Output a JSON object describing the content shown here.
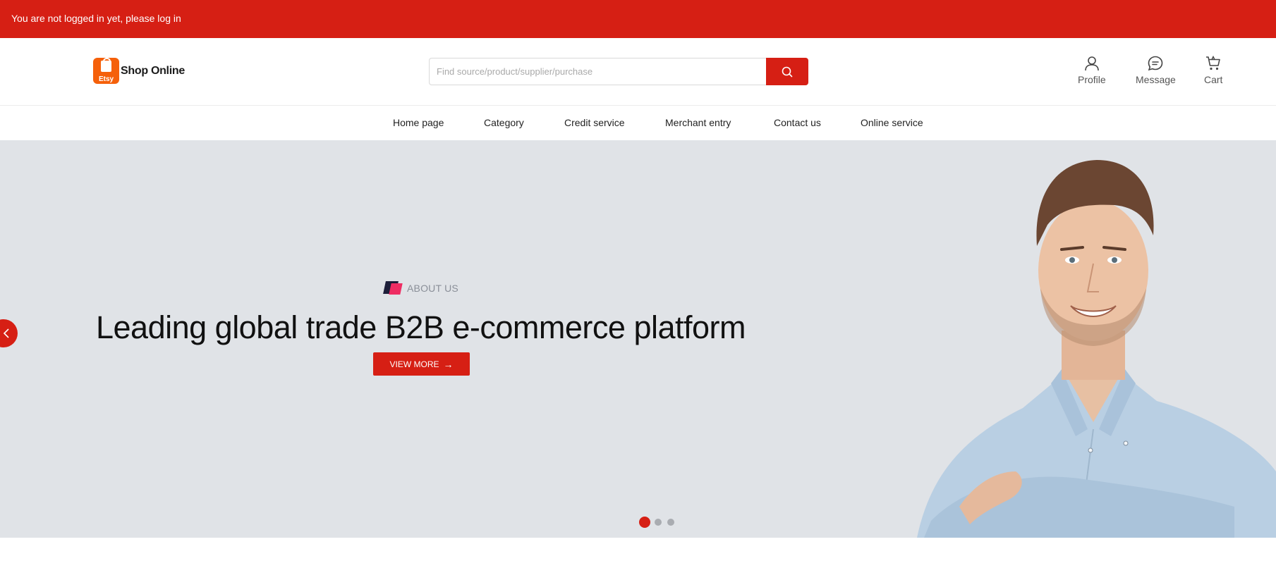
{
  "topbar": {
    "login_notice": "You are not logged in yet, please log in"
  },
  "header": {
    "logo": {
      "badge_text": "Etsy",
      "name": "Shop Online",
      "brand_color": "#f5600a"
    },
    "search": {
      "placeholder": "Find source/product/supplier/purchase",
      "value": "",
      "button_icon": "search-icon"
    },
    "actions": [
      {
        "label": "Profile",
        "icon": "user-icon"
      },
      {
        "label": "Message",
        "icon": "chat-icon"
      },
      {
        "label": "Cart",
        "icon": "cart-icon"
      }
    ]
  },
  "nav": {
    "items": [
      "Home page",
      "Category",
      "Credit service",
      "Merchant entry",
      "Contact us",
      "Online service"
    ]
  },
  "banner": {
    "eyebrow": "ABOUT US",
    "headline": "Leading global trade B2B e-commerce platform",
    "cta_label": "VIEW MORE",
    "cta_icon": "arrow-right-icon",
    "prev_icon": "chevron-left-icon",
    "slides": {
      "count": 3,
      "active": 1
    },
    "background_color": "#e0e3e7"
  },
  "colors": {
    "accent": "#d61f14",
    "text": "#222222"
  }
}
